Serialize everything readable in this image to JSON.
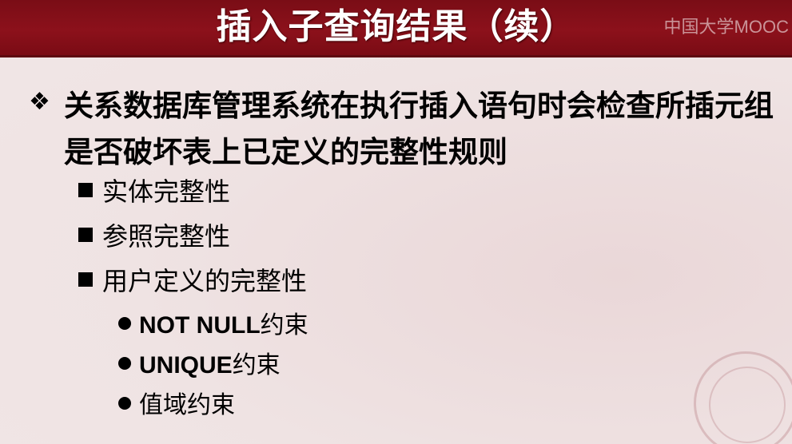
{
  "title": "插入子查询结果（续）",
  "watermark": "中国大学MOOC",
  "main_point": "关系数据库管理系统在执行插入语句时会检查所插元组是否破坏表上已定义的完整性规则",
  "sub_points": [
    "实体完整性",
    "参照完整性",
    "用户定义的完整性"
  ],
  "constraints": [
    {
      "en": "NOT NULL",
      "cn": "约束"
    },
    {
      "en": "UNIQUE",
      "cn": "约束"
    },
    {
      "en": "",
      "cn": "值域约束"
    }
  ],
  "icons": {
    "main_bullet": "diamond-bullet-icon",
    "sub_bullet": "square-bullet-icon",
    "constraint_bullet": "round-bullet-icon",
    "seal": "university-seal-icon"
  },
  "colors": {
    "header": "#8c111b",
    "background": "#efe2e2",
    "text": "#000000",
    "title_text": "#ffffff"
  }
}
